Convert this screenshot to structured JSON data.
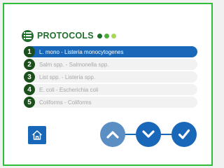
{
  "header": {
    "title": "PROTOCOLS",
    "icon": "list-icon",
    "dot_colors": [
      "#1f6e2c",
      "#4caf3a",
      "#a6d85a"
    ]
  },
  "protocols": [
    {
      "number": "1",
      "label": "L. mono - Listeria monocytogenes",
      "selected": true
    },
    {
      "number": "2",
      "label": "Salm spp. - Salmonella spp.",
      "selected": false
    },
    {
      "number": "3",
      "label": "List spp. - Listeria spp.",
      "selected": false
    },
    {
      "number": "4",
      "label": "E. coli - Escherichia coli",
      "selected": false
    },
    {
      "number": "5",
      "label": "Coliforms - Coliforms",
      "selected": false
    }
  ],
  "footer": {
    "home_icon": "home-icon",
    "buttons": [
      "chevron-up-icon",
      "chevron-down-icon",
      "checkmark-icon"
    ]
  },
  "colors": {
    "accent": "#1967b8",
    "frame": "#2fbe3a",
    "badge": "#1b4f1b"
  }
}
